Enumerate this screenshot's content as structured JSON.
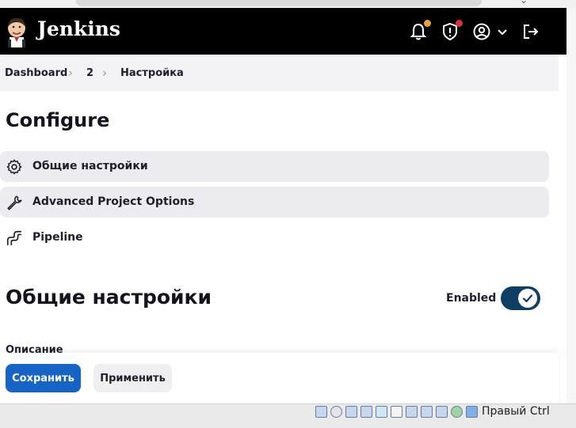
{
  "header": {
    "brand": "Jenkins",
    "notification_dot_color": "#f0a030",
    "security_dot_color": "#e0303c",
    "icons": [
      "jenkins-logo",
      "bell-icon",
      "shield-warning-icon",
      "user-icon",
      "chevron-down-icon",
      "logout-icon"
    ]
  },
  "breadcrumb": {
    "items": [
      "Dashboard",
      "2",
      "Настройка"
    ]
  },
  "page": {
    "title": "Configure"
  },
  "nav": {
    "items": [
      {
        "label": "Общие настройки",
        "icon": "gear-icon",
        "active": true
      },
      {
        "label": "Advanced Project Options",
        "icon": "wrench-icon",
        "active": false
      },
      {
        "label": "Pipeline",
        "icon": "pipeline-icon",
        "active": false
      }
    ]
  },
  "section": {
    "title": "Общие настройки",
    "enabled_label": "Enabled",
    "enabled": true,
    "description_label": "Описание"
  },
  "actions": {
    "save_label": "Сохранить",
    "apply_label": "Применить"
  },
  "vm_statusbar": {
    "host_key": "Правый Ctrl"
  },
  "colors": {
    "header_bg": "#000000",
    "primary": "#1564c6",
    "toggle_on": "#0f3f63"
  }
}
